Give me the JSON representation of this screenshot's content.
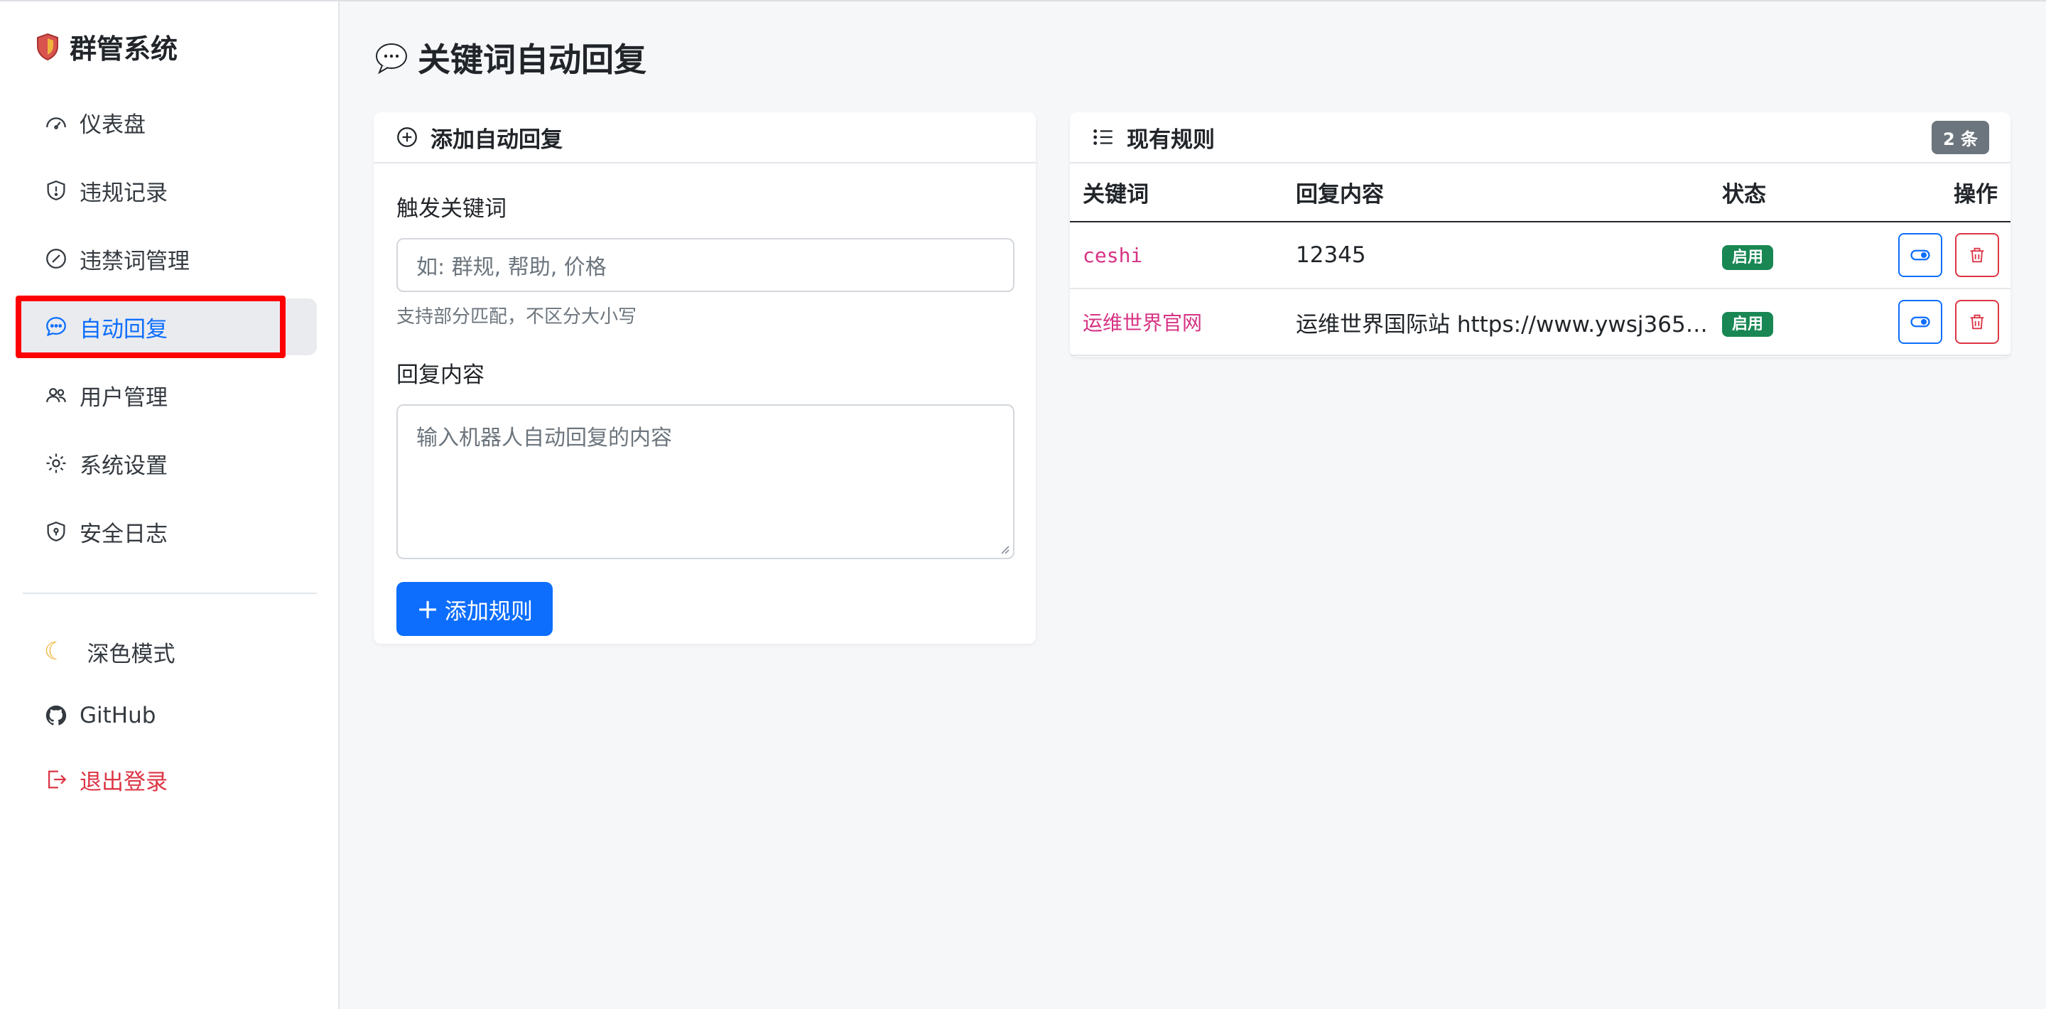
{
  "brand": {
    "title": "群管系统"
  },
  "nav": {
    "items": [
      {
        "label": "仪表盘",
        "icon": "speedometer-icon"
      },
      {
        "label": "违规记录",
        "icon": "shield-exclamation-icon"
      },
      {
        "label": "违禁词管理",
        "icon": "slash-circle-icon"
      },
      {
        "label": "自动回复",
        "icon": "chat-dots-icon",
        "active": true
      },
      {
        "label": "用户管理",
        "icon": "people-icon"
      },
      {
        "label": "系统设置",
        "icon": "gear-icon"
      },
      {
        "label": "安全日志",
        "icon": "shield-lock-icon"
      }
    ]
  },
  "bottom": {
    "dark_mode": "深色模式",
    "github": "GitHub",
    "logout": "退出登录"
  },
  "page": {
    "title": "关键词自动回复"
  },
  "add_card": {
    "title": "添加自动回复",
    "keyword_label": "触发关键词",
    "keyword_placeholder": "如: 群规, 帮助, 价格",
    "keyword_hint": "支持部分匹配，不区分大小写",
    "content_label": "回复内容",
    "content_placeholder": "输入机器人自动回复的内容",
    "submit_label": "添加规则"
  },
  "rules_card": {
    "title": "现有规则",
    "count": "2 条",
    "columns": [
      "关键词",
      "回复内容",
      "状态",
      "操作"
    ],
    "rows": [
      {
        "keyword": "ceshi",
        "content": "12345",
        "status": "启用"
      },
      {
        "keyword": "运维世界官网",
        "content": "运维世界国际站 https://www.ywsj365....",
        "status": "启用"
      }
    ]
  },
  "colors": {
    "primary": "#0d6efd",
    "danger": "#dc3545",
    "success": "#198754",
    "highlight": "#ff0000"
  }
}
